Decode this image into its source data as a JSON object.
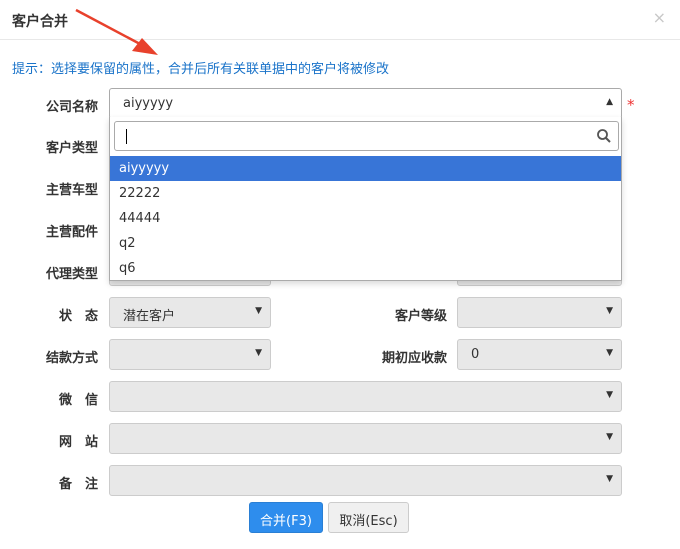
{
  "dialog": {
    "title": "客户合并",
    "close": "×"
  },
  "hint": "提示：选择要保留的属性，合并后所有关联单据中的客户将被修改",
  "fields": {
    "company_name": {
      "label": "公司名称",
      "value": "aiyyyyy",
      "required_mark": "*"
    },
    "customer_type": {
      "label": "客户类型"
    },
    "main_vehicle": {
      "label": "主营车型"
    },
    "main_parts": {
      "label": "主营配件"
    },
    "agent_type": {
      "label": "代理类型"
    },
    "status": {
      "label": "状　态",
      "value": "潜在客户"
    },
    "customer_level": {
      "label": "客户等级",
      "value": ""
    },
    "settlement": {
      "label": "结款方式",
      "value": ""
    },
    "opening_receivable": {
      "label": "期初应收款",
      "value": "0"
    },
    "wechat": {
      "label": "微　信",
      "value": ""
    },
    "website": {
      "label": "网　站",
      "value": ""
    },
    "remark": {
      "label": "备　注",
      "value": ""
    }
  },
  "dropdown": {
    "search_value": "",
    "options": [
      "aiyyyyy",
      "22222",
      "44444",
      "q2",
      "q6"
    ],
    "active_index": 0
  },
  "buttons": {
    "merge": "合并(F3)",
    "cancel": "取消(Esc)"
  },
  "colors": {
    "accent": "#2e8ded",
    "hint": "#1a73c9",
    "arrow": "#e8412c",
    "highlight": "#3875d7"
  }
}
